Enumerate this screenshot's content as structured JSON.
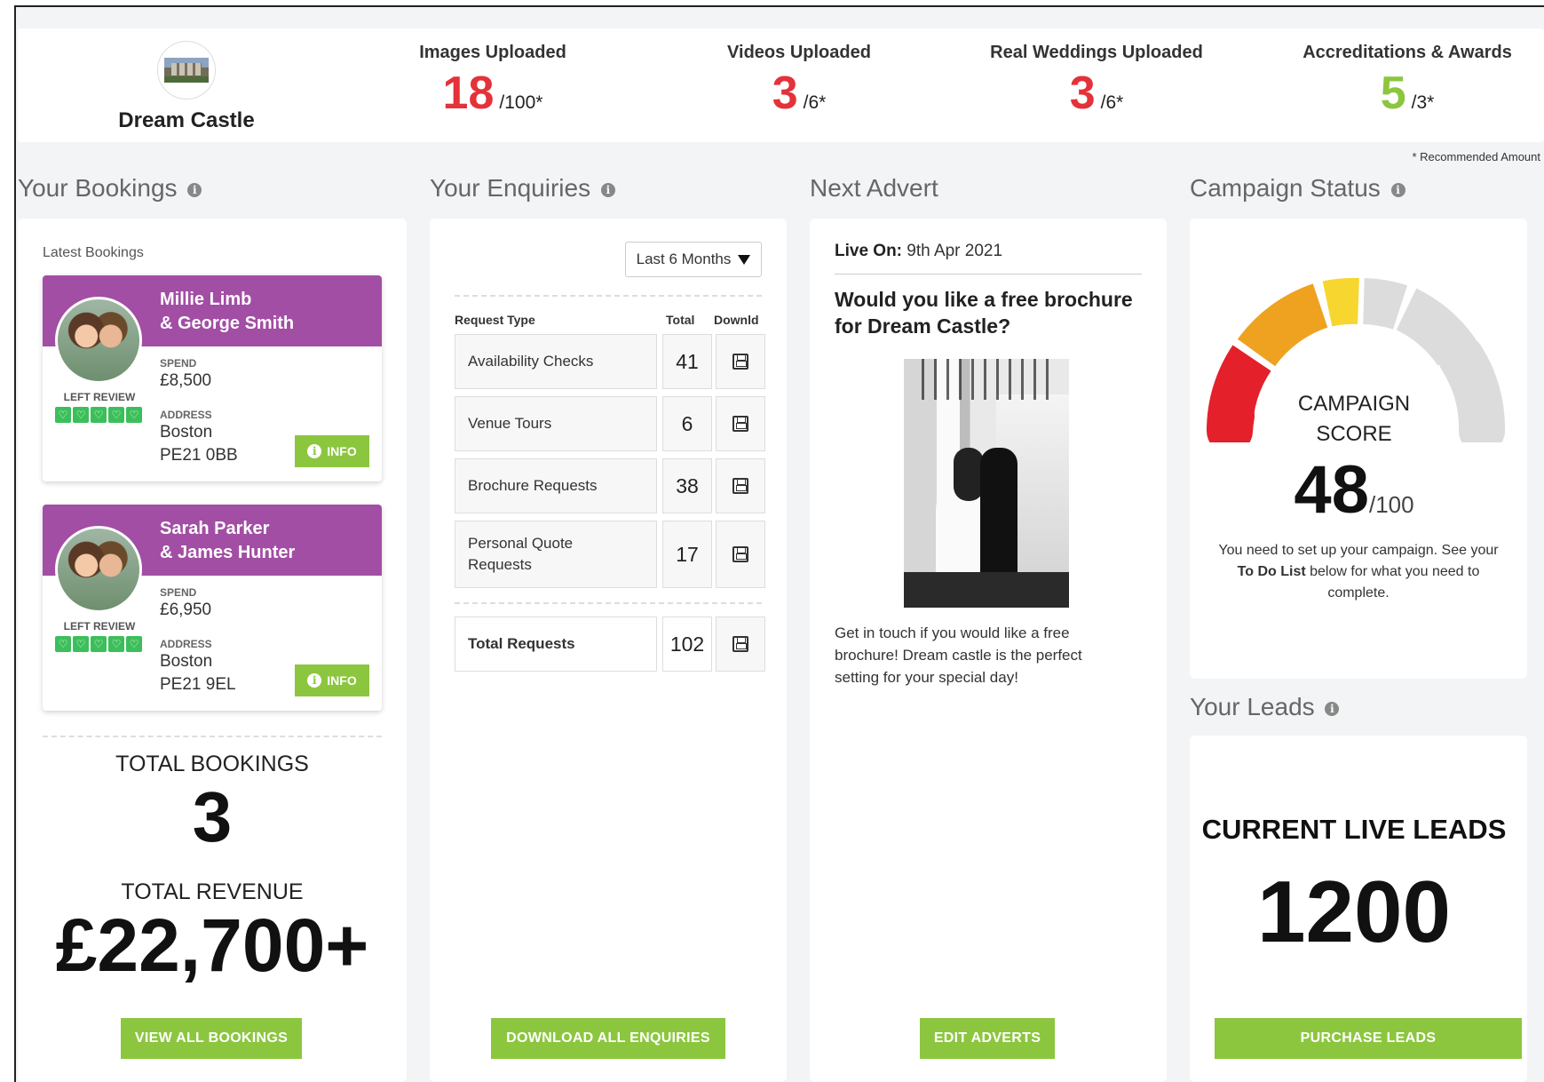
{
  "venue": {
    "name": "Dream Castle",
    "logo_icon": "castle-photo"
  },
  "stats": [
    {
      "label": "Images Uploaded",
      "value": "18",
      "max": "/100*",
      "color": "#e4323a"
    },
    {
      "label": "Videos Uploaded",
      "value": "3",
      "max": "/6*",
      "color": "#e4323a"
    },
    {
      "label": "Real Weddings Uploaded",
      "value": "3",
      "max": "/6*",
      "color": "#e4323a"
    },
    {
      "label": "Accreditations & Awards",
      "value": "5",
      "max": "/3*",
      "color": "#8cc63f"
    }
  ],
  "recommended_note": "* Recommended Amount",
  "bookings": {
    "title": "Your Bookings",
    "latest_label": "Latest Bookings",
    "items": [
      {
        "name_line1": "Millie Limb",
        "name_line2": "& George Smith",
        "left_review": "LEFT REVIEW",
        "rating": 5,
        "spend_label": "SPEND",
        "spend": "£8,500",
        "address_label": "ADDRESS",
        "address_line1": "Boston",
        "address_line2": "PE21 0BB",
        "info": "INFO"
      },
      {
        "name_line1": "Sarah Parker",
        "name_line2": "& James Hunter",
        "left_review": "LEFT REVIEW",
        "rating": 5,
        "spend_label": "SPEND",
        "spend": "£6,950",
        "address_label": "ADDRESS",
        "address_line1": "Boston",
        "address_line2": "PE21 9EL",
        "info": "INFO"
      }
    ],
    "total_bookings_label": "TOTAL BOOKINGS",
    "total_bookings": "3",
    "total_revenue_label": "TOTAL REVENUE",
    "total_revenue": "£22,700+",
    "button": "VIEW ALL BOOKINGS"
  },
  "enquiries": {
    "title": "Your Enquiries",
    "period": "Last 6 Months",
    "headers": {
      "type": "Request Type",
      "total": "Total",
      "download": "Downld"
    },
    "rows": [
      {
        "type": "Availability Checks",
        "total": "41"
      },
      {
        "type": "Venue Tours",
        "total": "6"
      },
      {
        "type": "Brochure Requests",
        "total": "38"
      },
      {
        "type_line1": "Personal Quote",
        "type_line2": "Requests",
        "total": "17"
      }
    ],
    "total_row": {
      "type": "Total Requests",
      "total": "102"
    },
    "button": "DOWNLOAD ALL ENQUIRIES"
  },
  "advert": {
    "title": "Next Advert",
    "live_label": "Live On:",
    "live_date": "9th Apr 2021",
    "headline_line1": "Would you like a free brochure",
    "headline_line2": "for Dream Castle?",
    "text_line1": "Get in touch if you would like a free",
    "text_line2": "brochure! Dream castle is the perfect",
    "text_line3": "setting for your special day!",
    "button": "EDIT ADVERTS"
  },
  "campaign": {
    "title": "Campaign Status",
    "label_line1": "CAMPAIGN",
    "label_line2": "SCORE",
    "score": "48",
    "max": "/100",
    "score_value": 48,
    "text_line1": "You need to set up your campaign. See your",
    "text_bold": "To Do List",
    "text_line2_rest": " below for what you need to",
    "text_line3": "complete."
  },
  "leads": {
    "title": "Your Leads",
    "label": "CURRENT LIVE LEADS",
    "value": "1200",
    "button": "PURCHASE LEADS"
  }
}
